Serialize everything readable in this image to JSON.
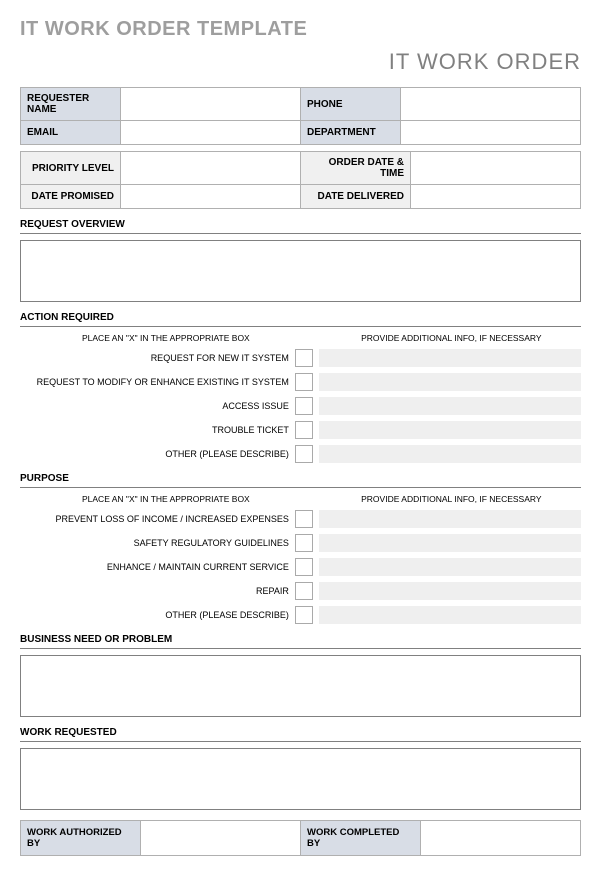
{
  "mainTitle": "IT WORK ORDER TEMPLATE",
  "docTitle": "IT WORK ORDER",
  "requesterInfo": {
    "requesterName": {
      "label": "REQUESTER NAME",
      "value": ""
    },
    "phone": {
      "label": "PHONE",
      "value": ""
    },
    "email": {
      "label": "EMAIL",
      "value": ""
    },
    "department": {
      "label": "DEPARTMENT",
      "value": ""
    }
  },
  "orderInfo": {
    "priorityLevel": {
      "label": "PRIORITY LEVEL",
      "value": ""
    },
    "orderDateTime": {
      "label": "ORDER DATE & TIME",
      "value": ""
    },
    "datePromised": {
      "label": "DATE PROMISED",
      "value": ""
    },
    "dateDelivered": {
      "label": "DATE DELIVERED",
      "value": ""
    }
  },
  "sections": {
    "requestOverview": "REQUEST OVERVIEW",
    "actionRequired": "ACTION REQUIRED",
    "purpose": "PURPOSE",
    "businessNeed": "BUSINESS NEED OR PROBLEM",
    "workRequested": "WORK REQUESTED"
  },
  "checklistHeaders": {
    "left": "PLACE AN \"X\" IN THE APPROPRIATE BOX",
    "right": "PROVIDE ADDITIONAL INFO, IF NECESSARY"
  },
  "actionItems": [
    "REQUEST FOR NEW IT SYSTEM",
    "REQUEST TO MODIFY OR ENHANCE EXISTING IT SYSTEM",
    "ACCESS ISSUE",
    "TROUBLE TICKET",
    "OTHER (PLEASE DESCRIBE)"
  ],
  "purposeItems": [
    "PREVENT LOSS OF INCOME / INCREASED EXPENSES",
    "SAFETY REGULATORY GUIDELINES",
    "ENHANCE / MAINTAIN CURRENT SERVICE",
    "REPAIR",
    "OTHER (PLEASE DESCRIBE)"
  ],
  "signatures": {
    "authorizedBy": {
      "label": "WORK AUTHORIZED BY",
      "value": ""
    },
    "completedBy": {
      "label": "WORK COMPLETED BY",
      "value": ""
    }
  }
}
